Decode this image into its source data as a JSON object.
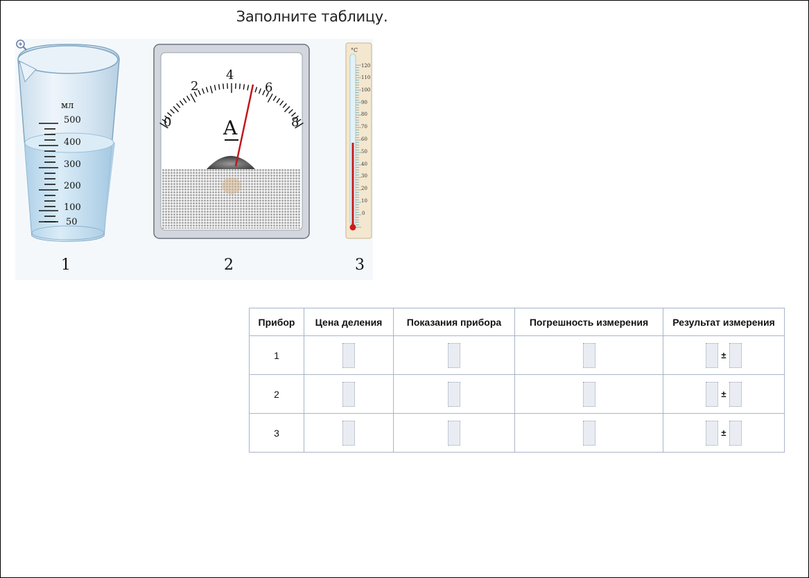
{
  "task": {
    "title": "Заполните таблицу."
  },
  "instruments": {
    "beaker": {
      "unit": "мл",
      "scale": [
        "500",
        "400",
        "300",
        "200",
        "100",
        "50"
      ],
      "caption": "1"
    },
    "ammeter": {
      "scale": [
        "0",
        "2",
        "4",
        "6",
        "8"
      ],
      "symbol": "A",
      "caption": "2"
    },
    "thermometer": {
      "unit": "°C",
      "scale": [
        "120",
        "110",
        "100",
        "90",
        "80",
        "70",
        "60",
        "50",
        "40",
        "30",
        "20",
        "10",
        "0"
      ],
      "caption": "3"
    },
    "zoom_icon": "zoom-in-icon"
  },
  "table": {
    "headers": [
      "Прибор",
      "Цена деления",
      "Показания прибора",
      "Погрешность измерения",
      "Результат измерения"
    ],
    "rows": [
      {
        "device": "1",
        "pm": "±"
      },
      {
        "device": "2",
        "pm": "±"
      },
      {
        "device": "3",
        "pm": "±"
      }
    ]
  }
}
